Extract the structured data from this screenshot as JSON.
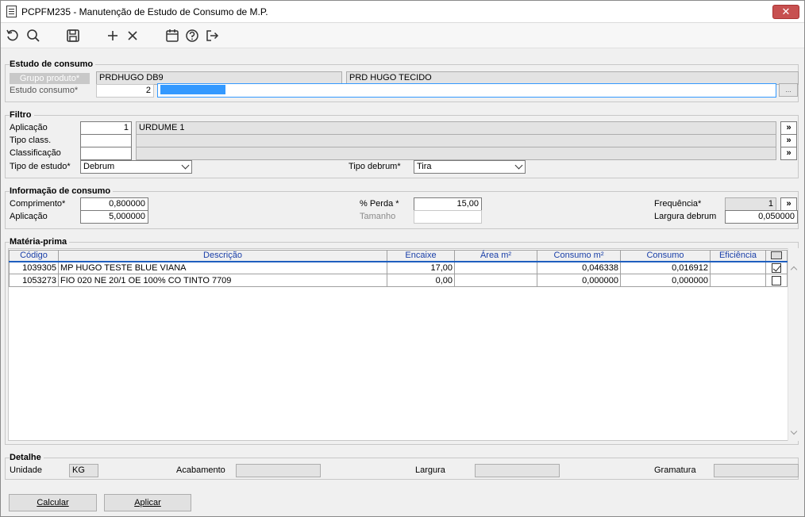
{
  "window": {
    "title": "PCPFM235 - Manutenção de Estudo de Consumo de M.P.",
    "close_label": "✕"
  },
  "toolbar": {
    "icons": [
      "refresh-icon",
      "search-icon",
      "save-icon",
      "add-icon",
      "delete-icon",
      "calendar-icon",
      "help-icon",
      "exit-icon"
    ]
  },
  "estudo": {
    "section_title": "Estudo de consumo",
    "grupo_label": "Grupo produto*",
    "grupo_code": "PRDHUGO DB9",
    "grupo_desc": "PRD HUGO TECIDO",
    "estudo_label": "Estudo consumo*",
    "estudo_num": "2",
    "estudo_desc": "",
    "ellipsis": "..."
  },
  "filtro": {
    "section_title": "Filtro",
    "aplicacao_label": "Aplicação",
    "aplicacao_code": "1",
    "aplicacao_desc": "URDUME 1",
    "tipo_class_label": "Tipo class.",
    "tipo_class_code": "",
    "tipo_class_desc": "",
    "classificacao_label": "Classificação",
    "classificacao_code": "",
    "classificacao_desc": "",
    "tipo_estudo_label": "Tipo de estudo*",
    "tipo_estudo_value": "Debrum",
    "tipo_debrum_label": "Tipo debrum*",
    "tipo_debrum_value": "Tira",
    "lookup": "»"
  },
  "info": {
    "section_title": "Informação de consumo",
    "comprimento_label": "Comprimento*",
    "comprimento": "0,800000",
    "aplicacao_label": "Aplicação",
    "aplicacao": "5,000000",
    "perda_label": "% Perda *",
    "perda": "15,00",
    "tamanho_label": "Tamanho",
    "tamanho": "",
    "frequencia_label": "Frequência*",
    "frequencia": "1",
    "largura_debrum_label": "Largura debrum",
    "largura_debrum": "0,050000",
    "lookup": "»"
  },
  "materia": {
    "section_title": "Matéria-prima",
    "columns": [
      "Código",
      "Descrição",
      "Encaixe",
      "Área m²",
      "Consumo m²",
      "Consumo",
      "Eficiência"
    ],
    "rows": [
      {
        "codigo": "1039305",
        "descricao": "MP HUGO TESTE BLUE VIANA",
        "encaixe": "17,00",
        "area": "",
        "consumo_m2": "0,046338",
        "consumo": "0,016912",
        "eficiencia": "",
        "checked": true
      },
      {
        "codigo": "1053273",
        "descricao": "FIO 020 NE 20/1 OE 100% CO TINTO 7709",
        "encaixe": "0,00",
        "area": "",
        "consumo_m2": "0,000000",
        "consumo": "0,000000",
        "eficiencia": "",
        "checked": false
      }
    ]
  },
  "detalhe": {
    "section_title": "Detalhe",
    "unidade_label": "Unidade",
    "unidade": "KG",
    "acabamento_label": "Acabamento",
    "acabamento": "",
    "largura_label": "Largura",
    "largura": "",
    "gramatura_label": "Gramatura",
    "gramatura": ""
  },
  "buttons": {
    "calcular": "Calcular",
    "aplicar": "Aplicar"
  }
}
